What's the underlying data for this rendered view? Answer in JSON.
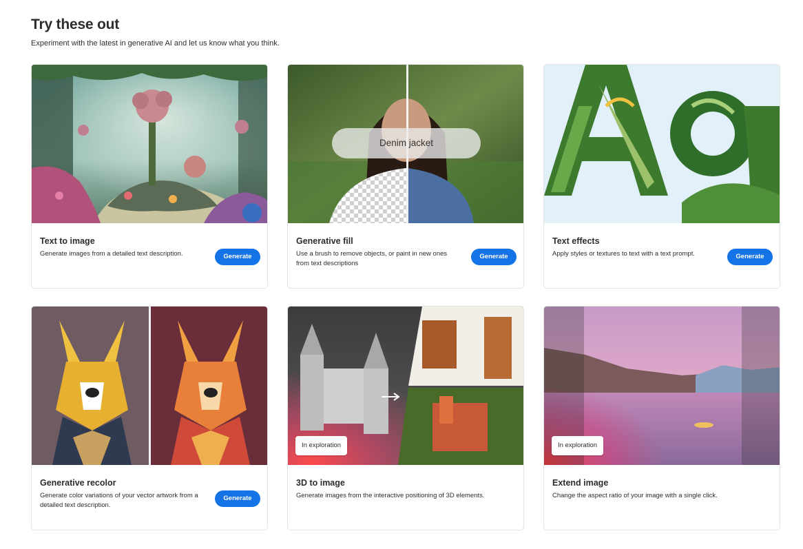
{
  "header": {
    "title": "Try these out",
    "subtitle": "Experiment with the latest in generative AI and let us know what you think."
  },
  "cards": [
    {
      "title": "Text to image",
      "description": "Generate images from a detailed text description.",
      "button": "Generate",
      "image_icon": "fantasy-garden-image"
    },
    {
      "title": "Generative fill",
      "description": "Use a brush to remove objects, or paint in new ones from text descriptions",
      "button": "Generate",
      "prompt_text": "Denim jacket",
      "image_icon": "portrait-fill-image"
    },
    {
      "title": "Text effects",
      "description": "Apply styles or textures to text with a text prompt.",
      "button": "Generate",
      "image_icon": "leaf-letters-image"
    },
    {
      "title": "Generative recolor",
      "description": "Generate color variations of your vector artwork from a detailed text description.",
      "button": "Generate",
      "image_icon": "dog-recolor-image"
    },
    {
      "title": "3D to image",
      "description": "Generate images from the interactive positioning of 3D elements.",
      "badge": "In exploration",
      "image_icon": "castle-3d-image"
    },
    {
      "title": "Extend image",
      "description": "Change the aspect ratio of your image with a single click.",
      "badge": "In exploration",
      "image_icon": "lake-landscape-image"
    }
  ],
  "colors": {
    "accent": "#1473e6",
    "text": "#2c2c2c",
    "border": "#e4e4e4"
  }
}
